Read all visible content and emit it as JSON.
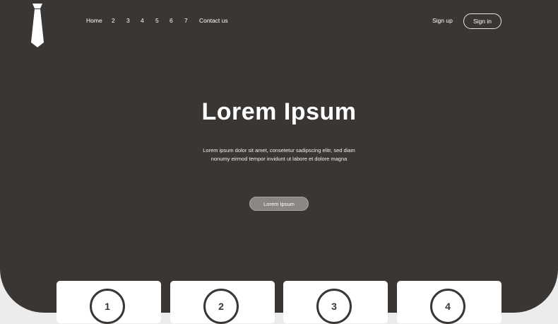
{
  "nav": {
    "links": [
      "Home",
      "2",
      "3",
      "4",
      "5",
      "6",
      "7",
      "Contact us"
    ]
  },
  "auth": {
    "signup_label": "Sign up",
    "signin_label": "Sign in"
  },
  "hero": {
    "title": "Lorem Ipsum",
    "description_line1": "Lorem ipsum dolor sit amet, consetetur sadipscing elitr, sed diam",
    "description_line2": "nonumy eirmod tempor invidunt ut labore et dolore magna",
    "button_label": "Lorem Ipsum"
  },
  "cards": [
    {
      "number": "1"
    },
    {
      "number": "2"
    },
    {
      "number": "3"
    },
    {
      "number": "4"
    }
  ],
  "colors": {
    "hero_background": "#3a3634",
    "page_background": "#ececec",
    "button_background": "#8a8684",
    "text_light": "#ffffff"
  },
  "icons": {
    "logo": "tie-icon"
  }
}
